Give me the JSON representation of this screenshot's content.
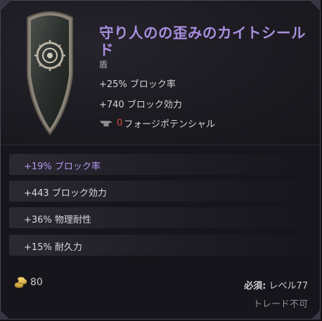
{
  "item": {
    "name": "守り人のの歪みのカイトシールド",
    "type": "盾",
    "implicits": [
      "+25% ブロック率",
      "+740 ブロック効力"
    ],
    "forge_potential_value": "0",
    "forge_potential_label": "フォージポテンシャル",
    "icon": "kite-shield-icon"
  },
  "affixes": [
    {
      "text": "+19% ブロック率",
      "color": "#b39bf0"
    },
    {
      "text": "+443 ブロック効力"
    },
    {
      "text": "+36% 物理耐性"
    },
    {
      "text": "+15% 耐久力"
    }
  ],
  "footer": {
    "gold_value": "80",
    "requirement_label": "必須:",
    "requirement_value": "レベル77",
    "trade_status": "トレード不可"
  },
  "colors": {
    "title": "#a98fe0",
    "highlight_affix": "#b39bf0",
    "forge_zero": "#d5483e",
    "background": "#16151b"
  }
}
